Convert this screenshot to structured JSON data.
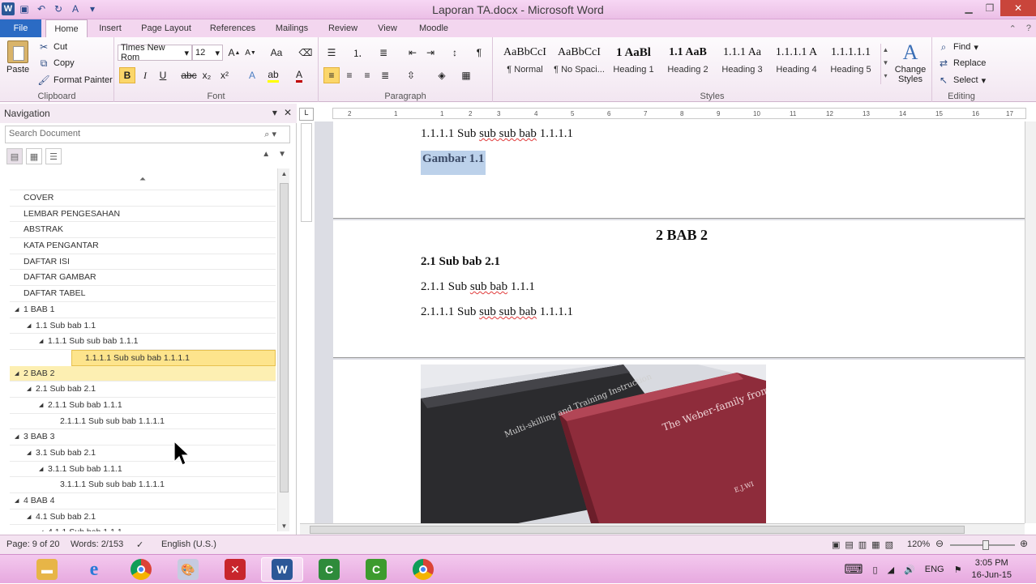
{
  "window": {
    "title": "Laporan TA.docx - Microsoft Word",
    "qat_icons": [
      "word-logo",
      "save-icon",
      "undo-icon",
      "redo-icon",
      "spelling-icon",
      "customize-qat-icon"
    ]
  },
  "tabs": [
    "File",
    "Home",
    "Insert",
    "Page Layout",
    "References",
    "Mailings",
    "Review",
    "View",
    "Moodle"
  ],
  "ribbon": {
    "clipboard": {
      "paste": "Paste",
      "cut": "Cut",
      "copy": "Copy",
      "format_painter": "Format Painter",
      "label": "Clipboard"
    },
    "font": {
      "name": "Times New Rom",
      "size": "12",
      "label": "Font"
    },
    "paragraph": {
      "label": "Paragraph"
    },
    "styles": {
      "items": [
        {
          "sample": "AaBbCcI",
          "name": "¶ Normal"
        },
        {
          "sample": "AaBbCcI",
          "name": "¶ No Spaci..."
        },
        {
          "sample": "1  AaBl",
          "name": "Heading 1"
        },
        {
          "sample": "1.1  AaB",
          "name": "Heading 2"
        },
        {
          "sample": "1.1.1  Aa",
          "name": "Heading 3"
        },
        {
          "sample": "1.1.1.1  A",
          "name": "Heading 4"
        },
        {
          "sample": "1.1.1.1.1",
          "name": "Heading 5"
        }
      ],
      "change_styles": "Change Styles",
      "label": "Styles"
    },
    "editing": {
      "find": "Find",
      "replace": "Replace",
      "select": "Select",
      "label": "Editing"
    }
  },
  "nav": {
    "title": "Navigation",
    "search_placeholder": "Search Document",
    "tree": [
      {
        "label": "COVER",
        "level": 0,
        "expanded": null,
        "state": ""
      },
      {
        "label": "LEMBAR PENGESAHAN",
        "level": 0,
        "expanded": null,
        "state": ""
      },
      {
        "label": "ABSTRAK",
        "level": 0,
        "expanded": null,
        "state": ""
      },
      {
        "label": "KATA PENGANTAR",
        "level": 0,
        "expanded": null,
        "state": ""
      },
      {
        "label": "DAFTAR ISI",
        "level": 0,
        "expanded": null,
        "state": ""
      },
      {
        "label": "DAFTAR GAMBAR",
        "level": 0,
        "expanded": null,
        "state": ""
      },
      {
        "label": "DAFTAR TABEL",
        "level": 0,
        "expanded": null,
        "state": ""
      },
      {
        "label": "1 BAB 1",
        "level": 0,
        "expanded": true,
        "state": ""
      },
      {
        "label": "1.1 Sub bab 1.1",
        "level": 1,
        "expanded": true,
        "state": ""
      },
      {
        "label": "1.1.1 Sub sub bab 1.1.1",
        "level": 2,
        "expanded": true,
        "state": ""
      },
      {
        "label": "1.1.1.1 Sub sub bab 1.1.1.1",
        "level": 3,
        "expanded": null,
        "state": "sel"
      },
      {
        "label": "2 BAB 2",
        "level": 0,
        "expanded": true,
        "state": "cur"
      },
      {
        "label": "2.1 Sub bab 2.1",
        "level": 1,
        "expanded": true,
        "state": ""
      },
      {
        "label": "2.1.1 Sub bab 1.1.1",
        "level": 2,
        "expanded": true,
        "state": ""
      },
      {
        "label": "2.1.1.1 Sub sub bab 1.1.1.1",
        "level": 3,
        "expanded": null,
        "state": ""
      },
      {
        "label": "3 BAB 3",
        "level": 0,
        "expanded": true,
        "state": ""
      },
      {
        "label": "3.1 Sub bab 2.1",
        "level": 1,
        "expanded": true,
        "state": ""
      },
      {
        "label": "3.1.1 Sub bab 1.1.1",
        "level": 2,
        "expanded": true,
        "state": ""
      },
      {
        "label": "3.1.1.1 Sub sub bab 1.1.1.1",
        "level": 3,
        "expanded": null,
        "state": ""
      },
      {
        "label": "4 BAB 4",
        "level": 0,
        "expanded": true,
        "state": ""
      },
      {
        "label": "4.1 Sub bab 2.1",
        "level": 1,
        "expanded": true,
        "state": ""
      },
      {
        "label": "4.1.1 Sub bab 1.1.1",
        "level": 2,
        "expanded": true,
        "state": ""
      }
    ]
  },
  "document": {
    "p1_line": "1.1.1.1    Sub sub sub bab 1.1.1.1",
    "p1_caption": "Gambar 1.1",
    "chapter": "2     BAB 2",
    "h2": "2.1      Sub bab 2.1",
    "h3": "2.1.1     Sub sub bab 1.1.1",
    "h4": "2.1.1.1    Sub sub sub bab 1.1.1.1",
    "photo": {
      "book1_spine": "Multi-skilling and Training Instruction",
      "book2_title": "The Weber-family from Genadendal",
      "book2_author": "E.J.WI"
    }
  },
  "ruler_numbers": [
    "2",
    "1",
    "1",
    "2",
    "3",
    "4",
    "5",
    "6",
    "7",
    "8",
    "9",
    "10",
    "11",
    "12",
    "13",
    "14",
    "15",
    "16",
    "17"
  ],
  "status": {
    "page": "Page: 9 of 20",
    "words": "Words: 2/153",
    "language": "English (U.S.)",
    "zoom": "120%"
  },
  "taskbar": {
    "apps": [
      "explorer",
      "internet-explorer",
      "chrome",
      "paint",
      "xmind",
      "word",
      "camtasia-recorder",
      "camtasia-studio",
      "chrome"
    ],
    "lang": "ENG",
    "time": "3:05 PM",
    "date": "16-Jun-15"
  }
}
